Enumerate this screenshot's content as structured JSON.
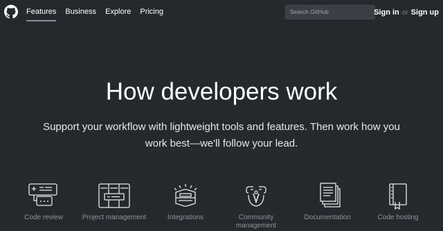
{
  "nav": {
    "items": [
      {
        "label": "Features",
        "active": true
      },
      {
        "label": "Business",
        "active": false
      },
      {
        "label": "Explore",
        "active": false
      },
      {
        "label": "Pricing",
        "active": false
      }
    ]
  },
  "search": {
    "placeholder": "Search GitHub"
  },
  "auth": {
    "signin": "Sign in",
    "or": "or",
    "signup": "Sign up"
  },
  "hero": {
    "title": "How developers work",
    "subtitle": "Support your workflow with lightweight tools and features. Then work how you work best—we'll follow your lead."
  },
  "features": [
    {
      "label": "Code review",
      "icon": "code-review-icon"
    },
    {
      "label": "Project management",
      "icon": "project-management-icon"
    },
    {
      "label": "Integrations",
      "icon": "integrations-icon"
    },
    {
      "label": "Community management",
      "icon": "community-management-icon"
    },
    {
      "label": "Documentation",
      "icon": "documentation-icon"
    },
    {
      "label": "Code hosting",
      "icon": "code-hosting-icon"
    }
  ],
  "colors": {
    "background": "#25292e",
    "text": "#ffffff",
    "muted": "#8e949a"
  }
}
